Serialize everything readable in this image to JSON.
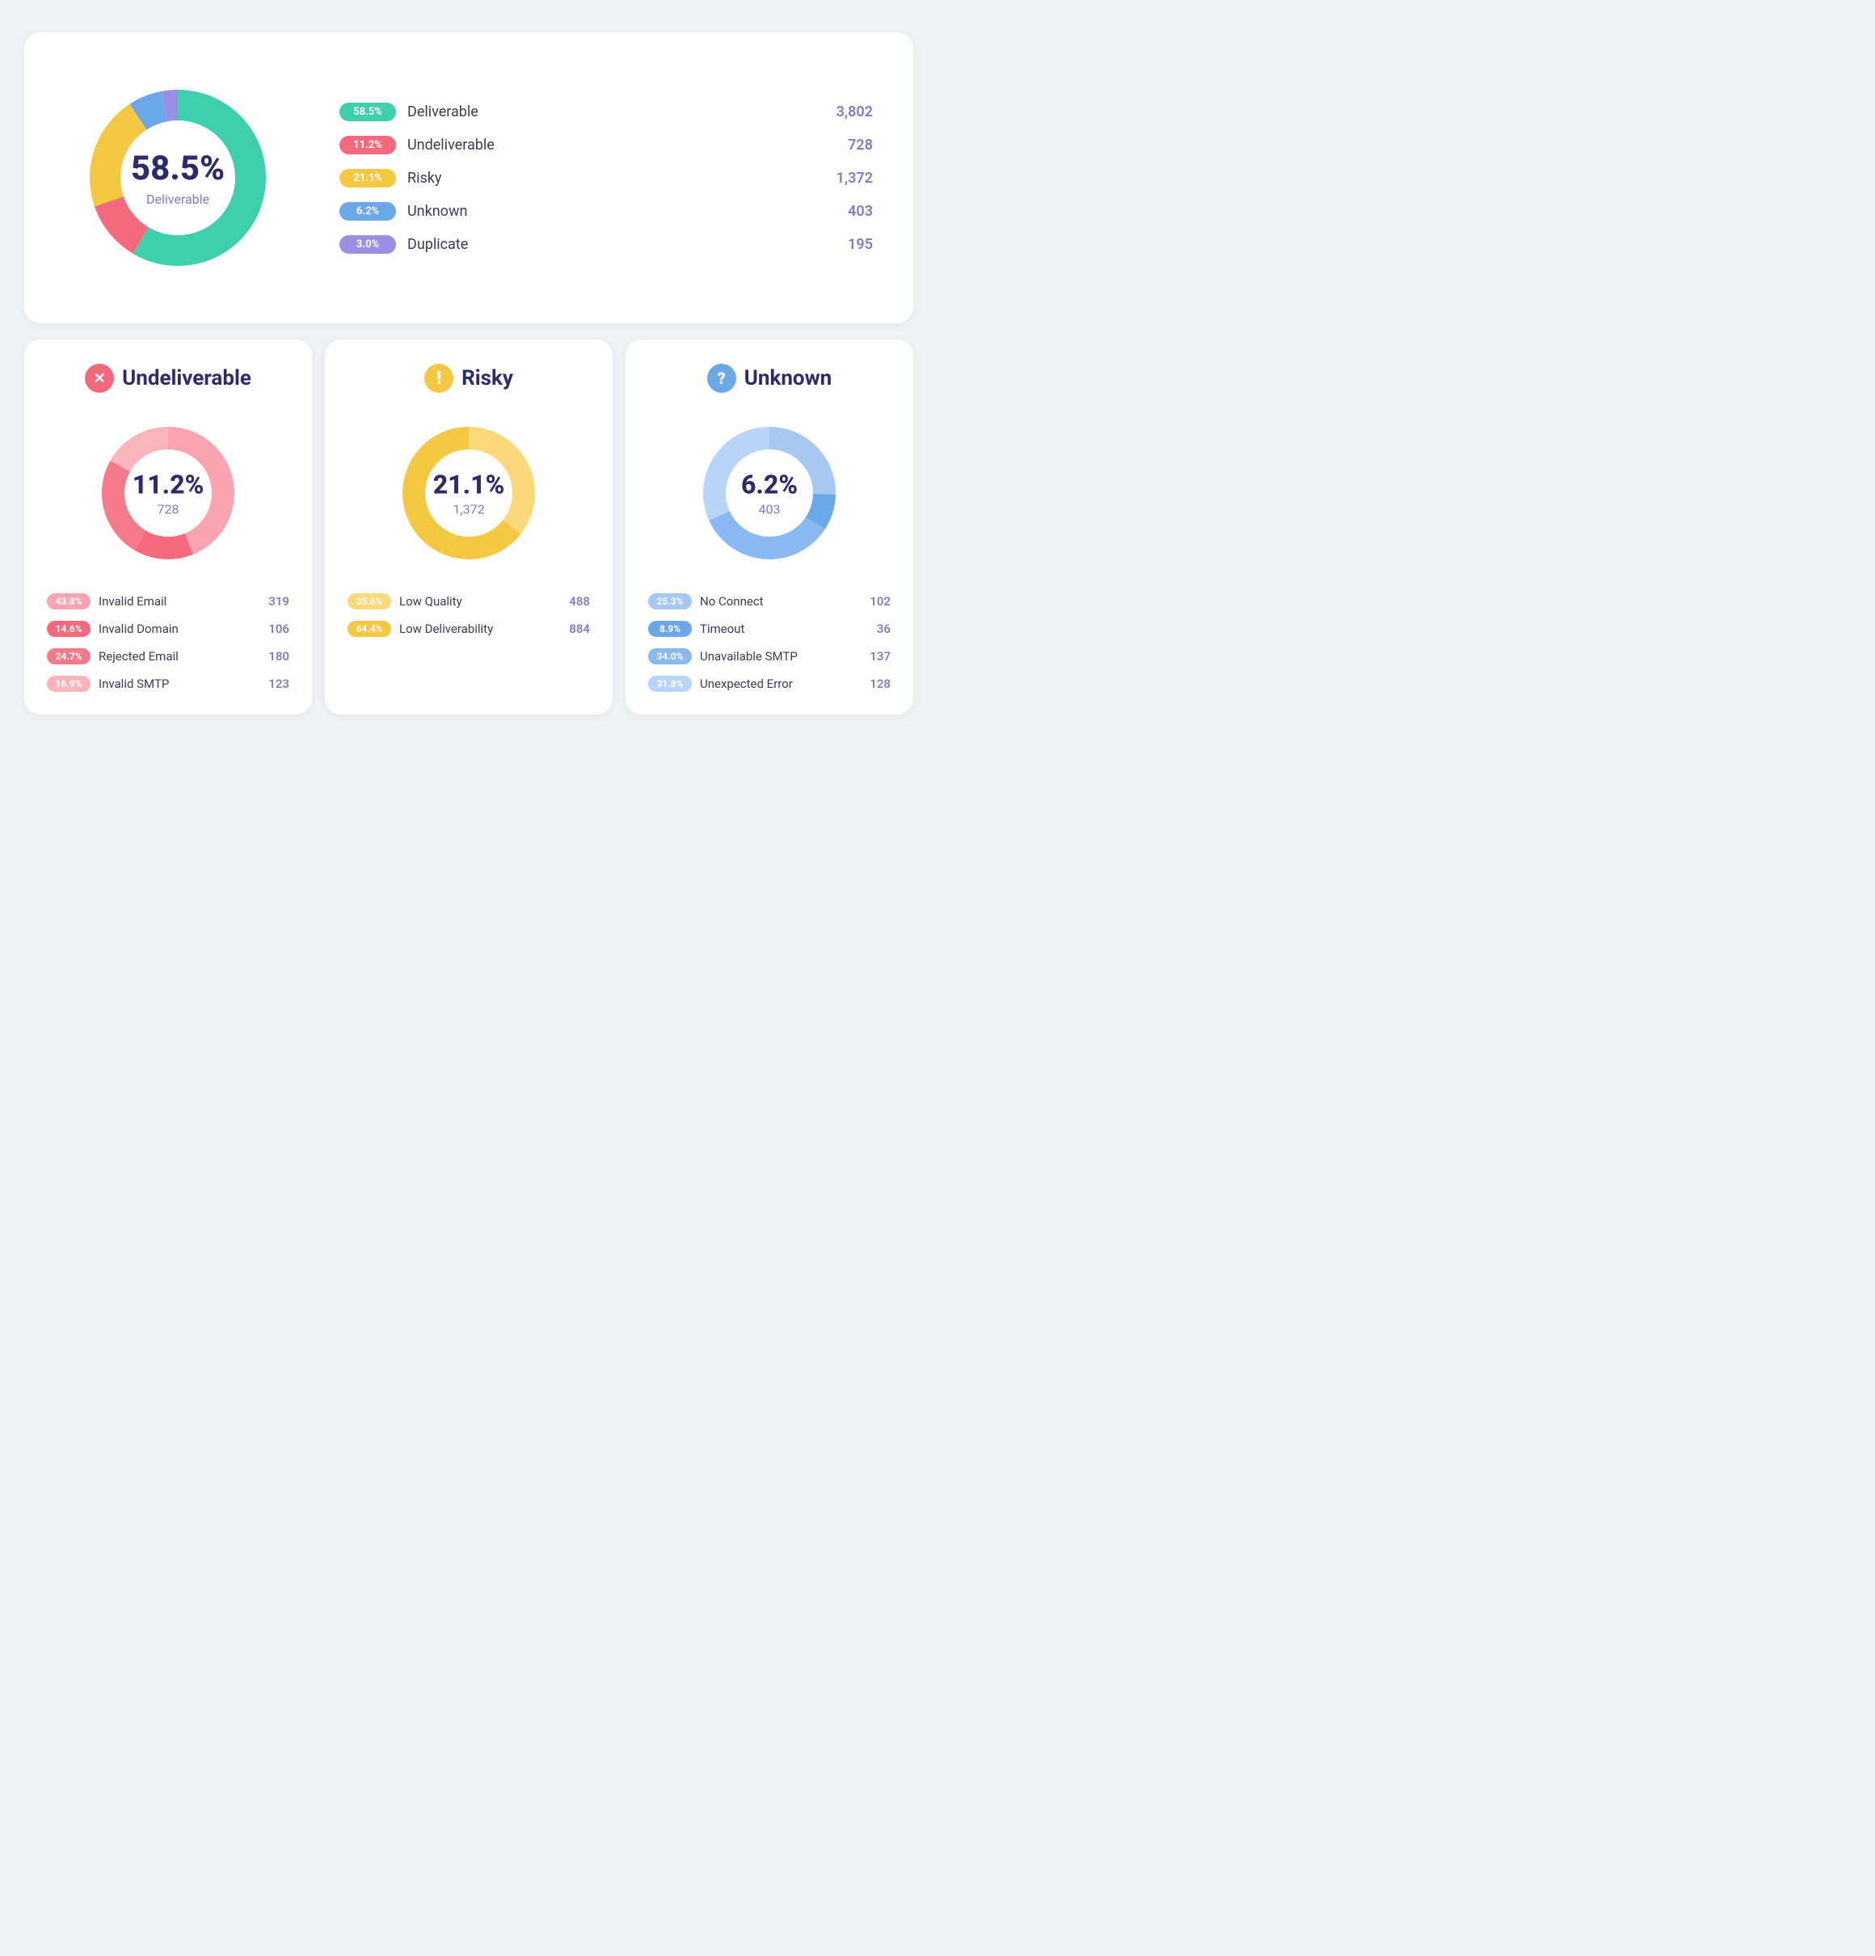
{
  "top": {
    "center_pct": "58.5%",
    "center_label": "Deliverable",
    "legend": [
      {
        "badge": "58.5%",
        "name": "Deliverable",
        "count": "3,802",
        "color": "#3ecfac"
      },
      {
        "badge": "11.2%",
        "name": "Undeliverable",
        "count": "728",
        "color": "#f4697b"
      },
      {
        "badge": "21.1%",
        "name": "Risky",
        "count": "1,372",
        "color": "#f5c842"
      },
      {
        "badge": "6.2%",
        "name": "Unknown",
        "count": "403",
        "color": "#6ba8e8"
      },
      {
        "badge": "3.0%",
        "name": "Duplicate",
        "count": "195",
        "color": "#9b8fe4"
      }
    ]
  },
  "undeliverable": {
    "title": "Undeliverable",
    "icon": "✕",
    "icon_bg": "#f4697b",
    "pct": "11.2%",
    "count": "728",
    "items": [
      {
        "badge": "43.8%",
        "name": "Invalid Email",
        "count": "319",
        "color": "#f9a4b0"
      },
      {
        "badge": "14.6%",
        "name": "Invalid Domain",
        "count": "106",
        "color": "#f4697b"
      },
      {
        "badge": "24.7%",
        "name": "Rejected Email",
        "count": "180",
        "color": "#f47a8a"
      },
      {
        "badge": "16.9%",
        "name": "Invalid SMTP",
        "count": "123",
        "color": "#f9b4bc"
      }
    ]
  },
  "risky": {
    "title": "Risky",
    "icon": "!",
    "icon_bg": "#f5c842",
    "pct": "21.1%",
    "count": "1,372",
    "items": [
      {
        "badge": "35.6%",
        "name": "Low Quality",
        "count": "488",
        "color": "#fad97a"
      },
      {
        "badge": "64.4%",
        "name": "Low Deliverability",
        "count": "884",
        "color": "#f5c842"
      }
    ]
  },
  "unknown": {
    "title": "Unknown",
    "icon": "?",
    "icon_bg": "#6ba8e8",
    "pct": "6.2%",
    "count": "403",
    "items": [
      {
        "badge": "25.3%",
        "name": "No Connect",
        "count": "102",
        "color": "#a8c8f4"
      },
      {
        "badge": "8.9%",
        "name": "Timeout",
        "count": "36",
        "color": "#6ba8e8"
      },
      {
        "badge": "34.0%",
        "name": "Unavailable SMTP",
        "count": "137",
        "color": "#8ab8f0"
      },
      {
        "badge": "31.8%",
        "name": "Unexpected Error",
        "count": "128",
        "color": "#b8d4f8"
      }
    ]
  }
}
